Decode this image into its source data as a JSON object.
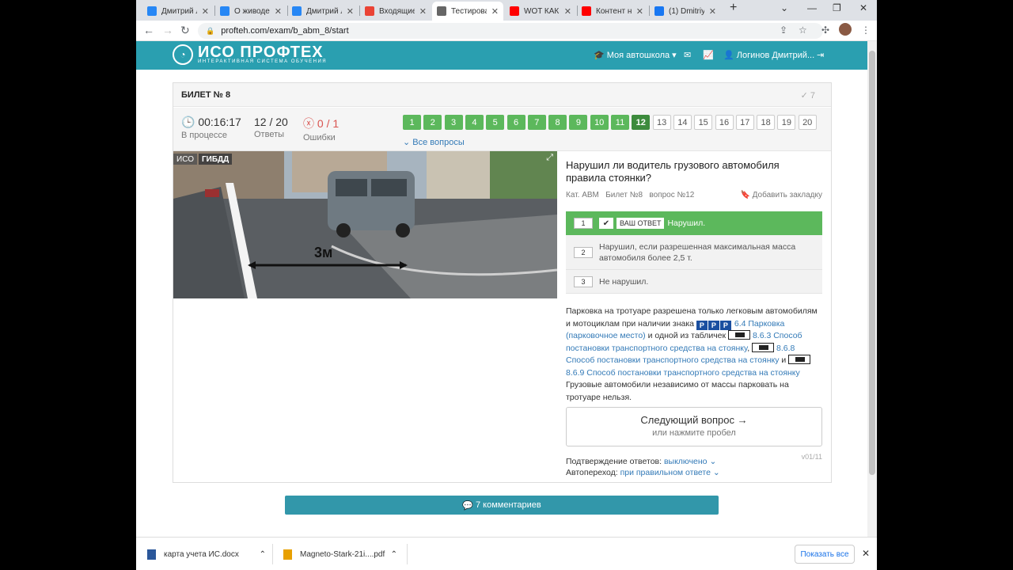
{
  "browser": {
    "tabs": [
      {
        "title": "Дмитрий Л",
        "icon": "vk-icon",
        "color": "#2787f5"
      },
      {
        "title": "О живодер",
        "icon": "vk-icon",
        "color": "#2787f5"
      },
      {
        "title": "Дмитрий Л",
        "icon": "vk-icon",
        "color": "#2787f5"
      },
      {
        "title": "Входящие",
        "icon": "gmail-icon",
        "color": "#ea4335"
      },
      {
        "title": "Тестирова",
        "icon": "globe-icon",
        "color": "#666666"
      },
      {
        "title": "WOT КАК Б",
        "icon": "youtube-icon",
        "color": "#ff0000"
      },
      {
        "title": "Контент на",
        "icon": "youtube-icon",
        "color": "#ff0000"
      },
      {
        "title": "(1) Dmitriy",
        "icon": "facebook-icon",
        "color": "#1877f2"
      }
    ],
    "active_tab": 4,
    "url": "profteh.com/exam/b_abm_8/start"
  },
  "site": {
    "brand": "ИСО ПРОФТЕХ",
    "brand_sub": "ИНТЕРАКТИВНАЯ СИСТЕМА ОБУЧЕНИЯ",
    "nav_school": "Моя автошкола",
    "nav_user": "Логинов Дмитрий...",
    "accent": "#2a9fb0"
  },
  "exam": {
    "ticket": "БИЛЕТ № 8",
    "corner_count": "7",
    "time": "00:16:17",
    "time_label": "В процессе",
    "answers": "12 / 20",
    "answers_label": "Ответы",
    "errors": "0 / 1",
    "errors_label": "Ошибки",
    "questions": [
      "1",
      "2",
      "3",
      "4",
      "5",
      "6",
      "7",
      "8",
      "9",
      "10",
      "11",
      "12",
      "13",
      "14",
      "15",
      "16",
      "17",
      "18",
      "19",
      "20"
    ],
    "current": 12,
    "all_questions": "Все вопросы"
  },
  "question": {
    "photo_badge_left": "ИСО",
    "photo_badge_right": "ГИБДД",
    "photo_distance": "3м",
    "text": "Нарушил ли водитель грузового автомобиля правила стоянки?",
    "meta": "Кат. ABM   Билет №8   вопрос №12",
    "bookmark": "Добавить закладку",
    "answers": [
      {
        "num": "1",
        "text": "Нарушил."
      },
      {
        "num": "2",
        "text": "Нарушил, если разрешенная максимальная масса автомобиля более 2,5 т."
      },
      {
        "num": "3",
        "text": "Не нарушил."
      }
    ],
    "your_answer": "ВАШ ОТВЕТ"
  },
  "explanation": {
    "t1": "Парковка на тротуаре разрешена только легковым автомобилям и мотоциклам при наличии знака ",
    "l1": "6.4 Парковка (парковочное место)",
    "t2": " и одной из табличек ",
    "l2": "8.6.3 Способ постановки транспортного средства на стоянку",
    "t3": ", ",
    "l3": "8.6.8 Способ постановки транспортного средства на стоянку",
    "t4": " и ",
    "l4": "8.6.9 Способ постановки транспортного средства на стоянку",
    "t5": " Грузовые автомобили независимо от массы парковать на тротуаре нельзя.",
    "sign_p": "P"
  },
  "next": {
    "label": "Следующий вопрос →",
    "hint": "или нажмите пробел",
    "version": "v01/11"
  },
  "options": {
    "confirm_label": "Подтверждение ответов:",
    "confirm_value": "выключено",
    "auto_label": "Автопереход:",
    "auto_value": "при правильном ответе"
  },
  "comments": "7 комментариев",
  "downloads": {
    "items": [
      {
        "name": "карта учета ИС.docx",
        "color": "#2b579a"
      },
      {
        "name": "Magneto-Stark-21i....pdf",
        "color": "#e8a000"
      }
    ],
    "show_all": "Показать все"
  }
}
